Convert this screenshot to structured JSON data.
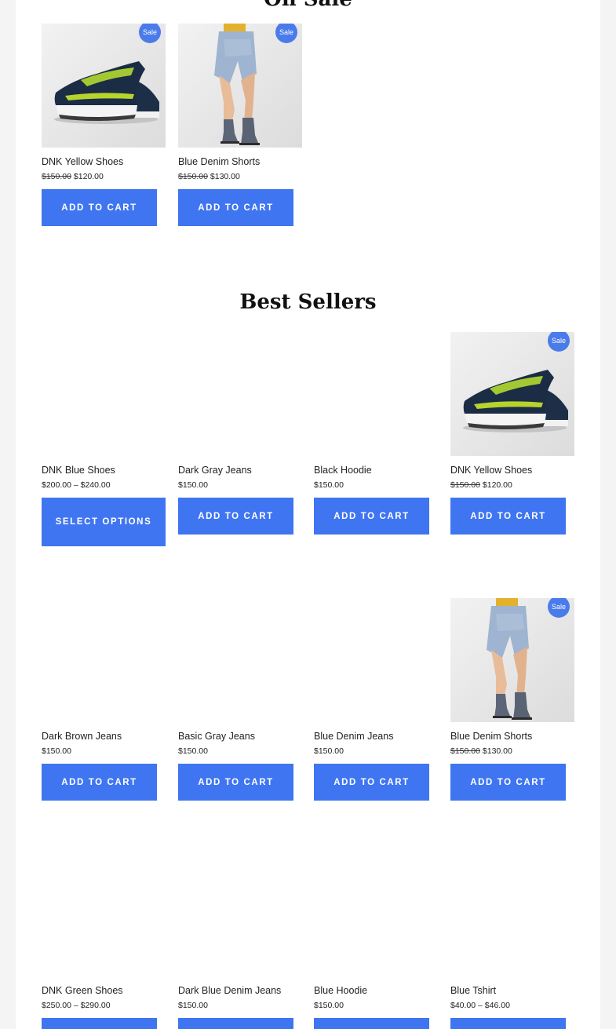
{
  "colors": {
    "accent": "#3f75f1",
    "badge": "#4a7bea",
    "background": "#f3f4f3"
  },
  "on_sale": {
    "title": "On Sale",
    "products": [
      {
        "name": "DNK Yellow Shoes",
        "old_price": "$150.00",
        "price": "$120.00",
        "badge": "Sale",
        "button": "ADD TO CART",
        "image": "sneaker"
      },
      {
        "name": "Blue Denim Shorts",
        "old_price": "$150.00",
        "price": "$130.00",
        "badge": "Sale",
        "button": "ADD TO CART",
        "image": "denim-shorts"
      }
    ]
  },
  "best_sellers": {
    "title": "Best Sellers",
    "products": [
      {
        "name": "DNK Blue Shoes",
        "price": "$200.00 – $240.00",
        "button": "SELECT OPTIONS"
      },
      {
        "name": "Dark Gray Jeans",
        "price": "$150.00",
        "button": "ADD TO CART"
      },
      {
        "name": "Black Hoodie",
        "price": "$150.00",
        "button": "ADD TO CART"
      },
      {
        "name": "DNK Yellow Shoes",
        "old_price": "$150.00",
        "price": "$120.00",
        "badge": "Sale",
        "button": "ADD TO CART",
        "image": "sneaker"
      },
      {
        "name": "Dark Brown Jeans",
        "price": "$150.00",
        "button": "ADD TO CART"
      },
      {
        "name": "Basic Gray Jeans",
        "price": "$150.00",
        "button": "ADD TO CART"
      },
      {
        "name": "Blue Denim Jeans",
        "price": "$150.00",
        "button": "ADD TO CART"
      },
      {
        "name": "Blue Denim Shorts",
        "old_price": "$150.00",
        "price": "$130.00",
        "badge": "Sale",
        "button": "ADD TO CART",
        "image": "denim-shorts"
      },
      {
        "name": "DNK Green Shoes",
        "price": "$250.00 – $290.00",
        "button": ""
      },
      {
        "name": "Dark Blue Denim Jeans",
        "price": "$150.00",
        "button": ""
      },
      {
        "name": "Blue Hoodie",
        "price": "$150.00",
        "button": ""
      },
      {
        "name": "Blue Tshirt",
        "price": "$40.00 – $46.00",
        "button": ""
      }
    ]
  }
}
